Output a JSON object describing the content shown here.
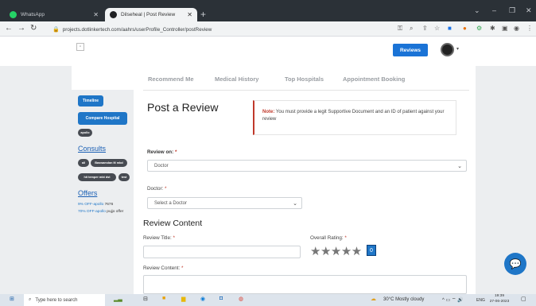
{
  "browser": {
    "tabs": [
      {
        "title": "WhatsApp",
        "color": "#25d366"
      },
      {
        "title": "Dilseheal | Post Review",
        "color": "#202124"
      }
    ],
    "new_tab": "+",
    "url": "projects.dotlinkertech.com/aahrs/userProfile_Controller/postReview",
    "window_controls": [
      "⌄",
      "–",
      "❐",
      "✕"
    ]
  },
  "header": {
    "reviews_button": "Reviews",
    "logo_alt": "broken-image-icon"
  },
  "top_nav": [
    "Recommend Me",
    "Medical History",
    "Top Hospitals",
    "Appointment Booking"
  ],
  "sidebar": {
    "timeline": "Timeline",
    "compare_hospital": "Compare Hospital",
    "tag_apollo": "apollo",
    "consults_heading": "Consults",
    "consult_pills": [
      "all",
      "Baswamdan M mbd",
      "hit temper mbt dst",
      "test"
    ],
    "offers_heading": "Offers",
    "offers": [
      {
        "link": "9% OFF-apollo",
        "rest": " 7676"
      },
      {
        "link": "70% OFF-apollo",
        "rest": " pujjo offer"
      }
    ]
  },
  "form": {
    "page_title": "Post a Review",
    "note_label": "Note:",
    "note_text": " You must provide a legit Supportive Document and an ID of patient against your review",
    "review_on_label": "Review on:",
    "review_on_value": "Doctor",
    "doctor_label": "Doctor:",
    "doctor_placeholder": "Select a Doctor",
    "review_content_heading": "Review Content",
    "review_title_label": "Review Title:",
    "overall_rating_label": "Overall Rating:",
    "rating_value": "0",
    "review_content_label": "Review Content:",
    "required_mark": "*"
  },
  "taskbar": {
    "search_placeholder": "Type here to search",
    "weather": "30°C  Mostly cloudy",
    "language": "ENG",
    "time": "19:39",
    "date": "27-06-2023"
  },
  "colors": {
    "accent": "#1f76c7",
    "note_border": "#c0392b"
  }
}
